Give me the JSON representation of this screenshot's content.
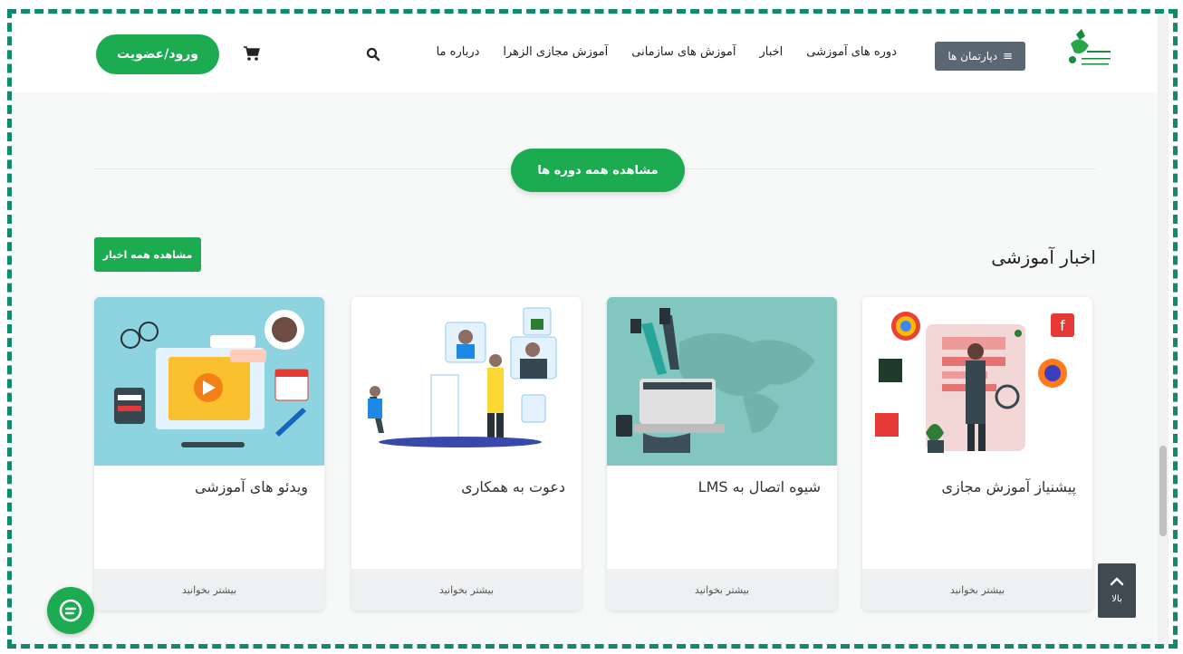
{
  "header": {
    "departments_label": "دپارتمان ها",
    "nav": [
      "دوره های آموزشی",
      "اخبار",
      "آموزش های سازمانی",
      "آموزش مجازی الزهرا",
      "درباره ما"
    ],
    "login_label": "ورود/عضویت"
  },
  "main": {
    "all_courses_label": "مشاهده همه دوره ها",
    "news_title": "اخبار آموزشی",
    "all_news_label": "مشاهده همه اخبار",
    "cards": [
      {
        "title": "پیشنیاز آموزش مجازی",
        "footer": "بیشتر بخوانید"
      },
      {
        "title": "شیوه اتصال به LMS",
        "footer": "بیشتر بخوانید"
      },
      {
        "title": "دعوت به همکاری",
        "footer": "بیشتر بخوانید"
      },
      {
        "title": "ویدئو های آموزشی",
        "footer": "بیشتر بخوانید"
      }
    ]
  },
  "widgets": {
    "back_to_top_label": "بالا"
  },
  "colors": {
    "accent": "#1dab52",
    "frame": "#0e8a6c",
    "dark_button": "#5b6772"
  }
}
